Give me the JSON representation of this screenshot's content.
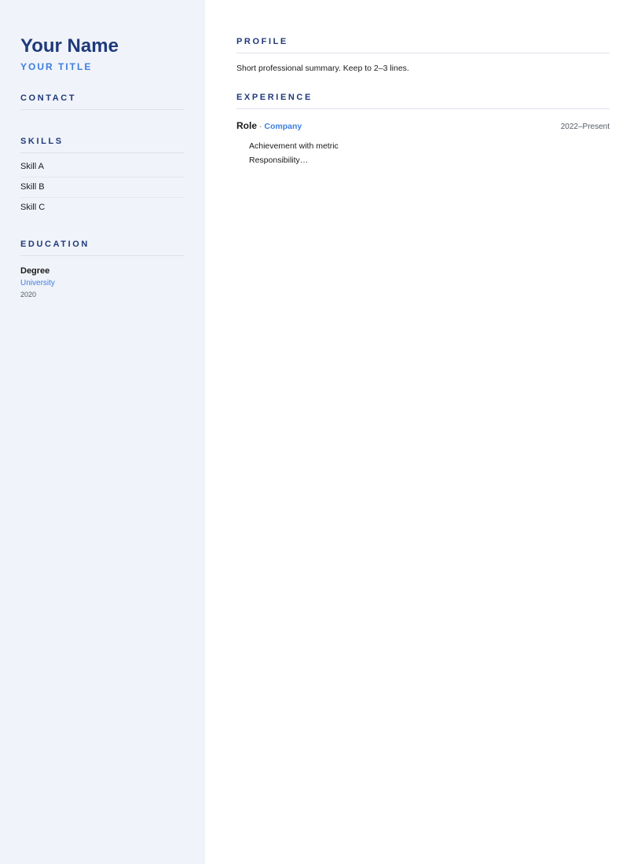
{
  "sidebar": {
    "name": "Your Name",
    "title": "YOUR TITLE",
    "contact_heading": "CONTACT",
    "skills_heading": "SKILLS",
    "skills": [
      "Skill A",
      "Skill B",
      "Skill C"
    ],
    "education_heading": "EDUCATION",
    "education": {
      "degree": "Degree",
      "school": "University",
      "year": "2020"
    }
  },
  "main": {
    "profile_heading": "PROFILE",
    "profile_text": "Short professional summary. Keep to 2–3 lines.",
    "experience_heading": "EXPERIENCE",
    "jobs": [
      {
        "role": "Role",
        "separator": "·",
        "company": "Company",
        "dates": "2022–Present",
        "bullets": [
          "Achievement with metric",
          "Responsibility…"
        ]
      }
    ]
  },
  "colors": {
    "sidebar_bg": "#f0f3f9",
    "heading": "#1f3a7a",
    "accent": "#3d7fe0",
    "text": "#1a1a1a",
    "muted": "#555b66"
  }
}
